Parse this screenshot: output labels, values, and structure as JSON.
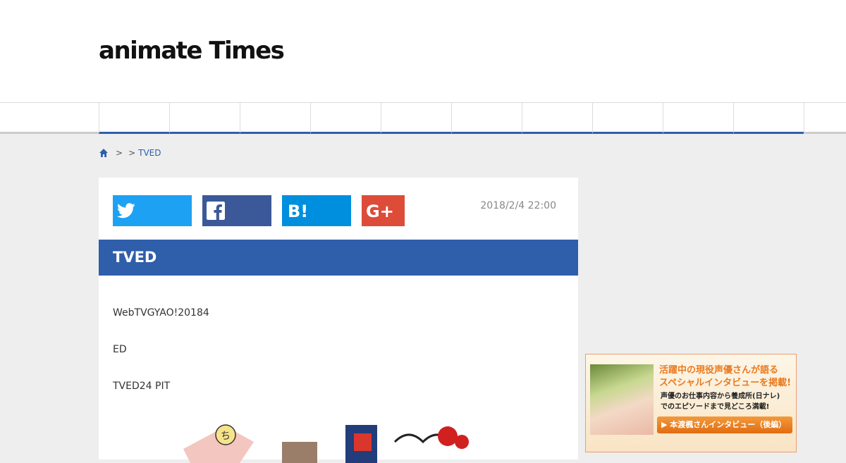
{
  "header": {
    "logo_text": "animate Times"
  },
  "nav": {
    "item_count": 10
  },
  "breadcrumb": {
    "home_icon": "home-icon",
    "separator_1": ">",
    "separator_2": ">",
    "current": "TVED"
  },
  "article": {
    "share": {
      "twitter_icon": "twitter-icon",
      "facebook_icon": "facebook-icon",
      "hatena_icon": "hatena-bookmark-icon",
      "googleplus_icon": "google-plus-icon",
      "colors": {
        "twitter": "#1da1f2",
        "facebook": "#3b5998",
        "hatena": "#008fde",
        "googleplus": "#dd4b39"
      }
    },
    "date": "2018/2/4 22:00",
    "title": "TVED",
    "paragraphs": [
      "WebTVGYAO!20184",
      "ED",
      "TVED24 PIT"
    ]
  },
  "ad": {
    "headline_1": "活躍中の現役声優さんが語る",
    "headline_2": "スペシャルインタビューを掲載!",
    "sub_1": "声優のお仕事内容から養成所(日ナレ)",
    "sub_2": "でのエピソードまで見どころ満載!",
    "button": "▶ 本渡楓さんインタビュー（後編）"
  },
  "colors": {
    "accent": "#2f5eab",
    "page_bg": "#eeeeee"
  }
}
